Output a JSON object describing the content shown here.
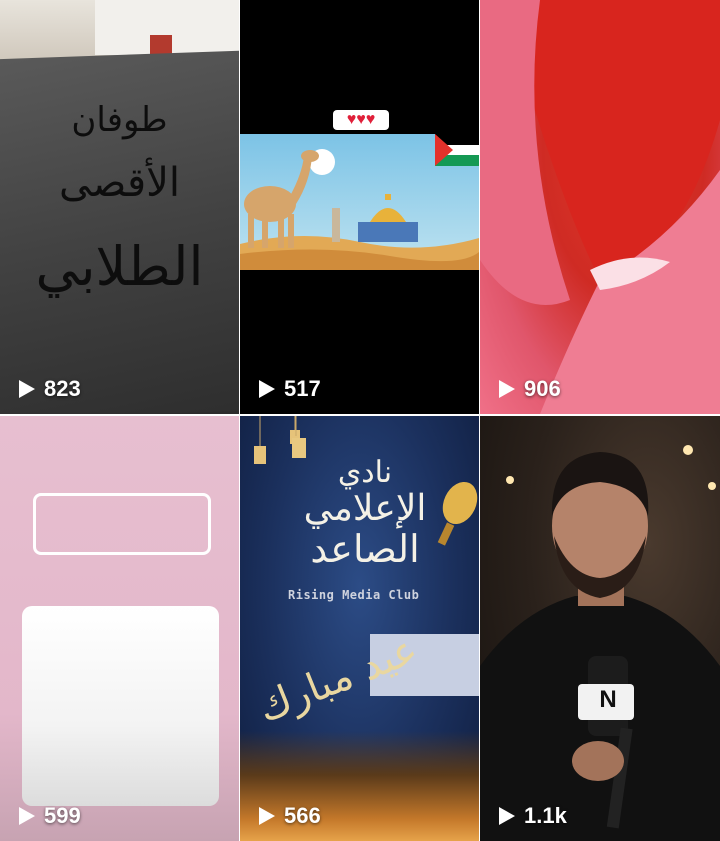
{
  "videos": [
    {
      "views": "823",
      "thumbnail": {
        "subject": "handwritten-sign",
        "sign_lines": [
          "طوفان",
          "الأقصى",
          "الطلابي"
        ]
      }
    },
    {
      "views": "517",
      "thumbnail": {
        "subject": "camel-al-aqsa-illustration",
        "hearts": "♥♥♥"
      }
    },
    {
      "views": "906",
      "thumbnail": {
        "subject": "red-fabric"
      }
    },
    {
      "views": "599",
      "thumbnail": {
        "subject": "pink-placeholder-boxes"
      }
    },
    {
      "views": "566",
      "thumbnail": {
        "subject": "ramadan-media-club",
        "title_lines": [
          "نادي",
          "الإعلامي",
          "الصاعد"
        ],
        "club_name": "Rising Media Club",
        "calligraphy": "عيد مبارك"
      }
    },
    {
      "views": "1.1k",
      "thumbnail": {
        "subject": "reporter-with-microphone",
        "mic_logo": "N"
      }
    }
  ],
  "icons": {
    "play": "play-icon"
  },
  "colors": {
    "overlay_text": "#ffffff",
    "background": "#ffffff"
  }
}
